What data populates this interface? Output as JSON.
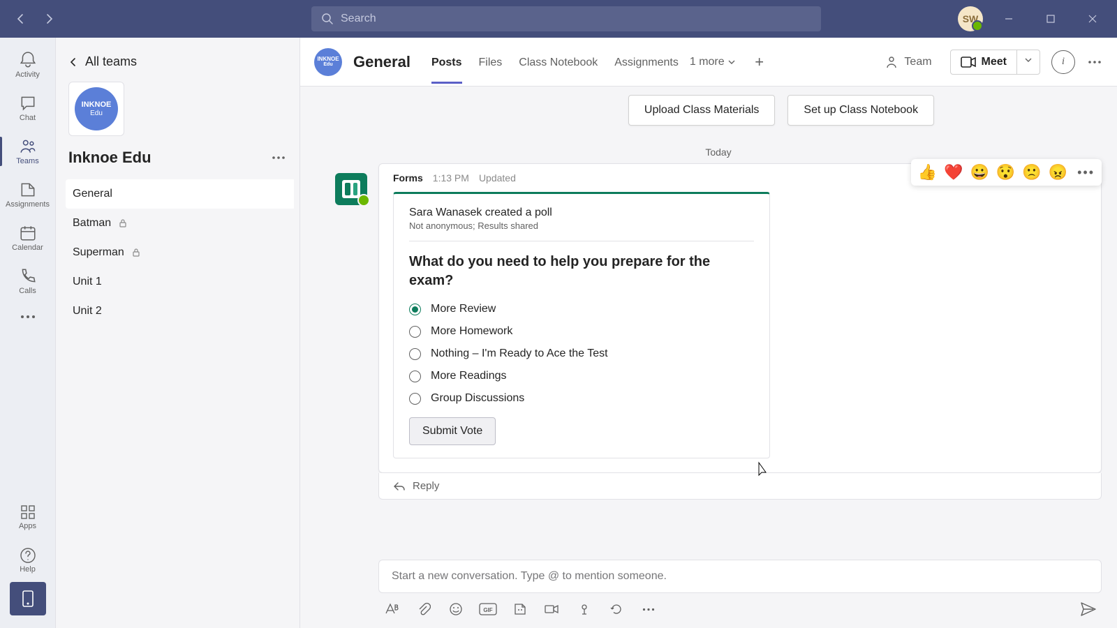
{
  "search": {
    "placeholder": "Search"
  },
  "avatar": {
    "initials": "SW"
  },
  "rail": {
    "items": [
      "Activity",
      "Chat",
      "Teams",
      "Assignments",
      "Calendar",
      "Calls"
    ],
    "apps": "Apps",
    "help": "Help"
  },
  "team_panel": {
    "back_label": "All teams",
    "logo_line1": "INKNOE",
    "logo_line2": "Edu",
    "team_name": "Inknoe Edu",
    "channels": [
      {
        "name": "General",
        "active": true,
        "locked": false
      },
      {
        "name": "Batman",
        "active": false,
        "locked": true
      },
      {
        "name": "Superman",
        "active": false,
        "locked": true
      },
      {
        "name": "Unit 1",
        "active": false,
        "locked": false
      },
      {
        "name": "Unit 2",
        "active": false,
        "locked": false
      }
    ]
  },
  "header": {
    "channel": "General",
    "tabs": [
      "Posts",
      "Files",
      "Class Notebook",
      "Assignments"
    ],
    "more_tabs": "1 more",
    "team_btn": "Team",
    "meet_btn": "Meet"
  },
  "content": {
    "upload_btn": "Upload Class Materials",
    "setup_btn": "Set up Class Notebook",
    "date": "Today",
    "reactions": [
      "👍",
      "❤️",
      "😀",
      "😯",
      "🙁",
      "😠"
    ]
  },
  "message": {
    "app": "Forms",
    "time": "1:13 PM",
    "status": "Updated",
    "poll_author": "Sara Wanasek created a poll",
    "poll_sub": "Not anonymous; Results shared",
    "poll_question": "What do you need to help you prepare for the exam?",
    "options": [
      {
        "label": "More Review",
        "selected": true
      },
      {
        "label": "More Homework",
        "selected": false
      },
      {
        "label": "Nothing – I'm Ready to Ace the Test",
        "selected": false
      },
      {
        "label": "More Readings",
        "selected": false
      },
      {
        "label": "Group Discussions",
        "selected": false
      }
    ],
    "submit": "Submit Vote",
    "reply": "Reply"
  },
  "compose": {
    "placeholder": "Start a new conversation. Type @ to mention someone."
  }
}
